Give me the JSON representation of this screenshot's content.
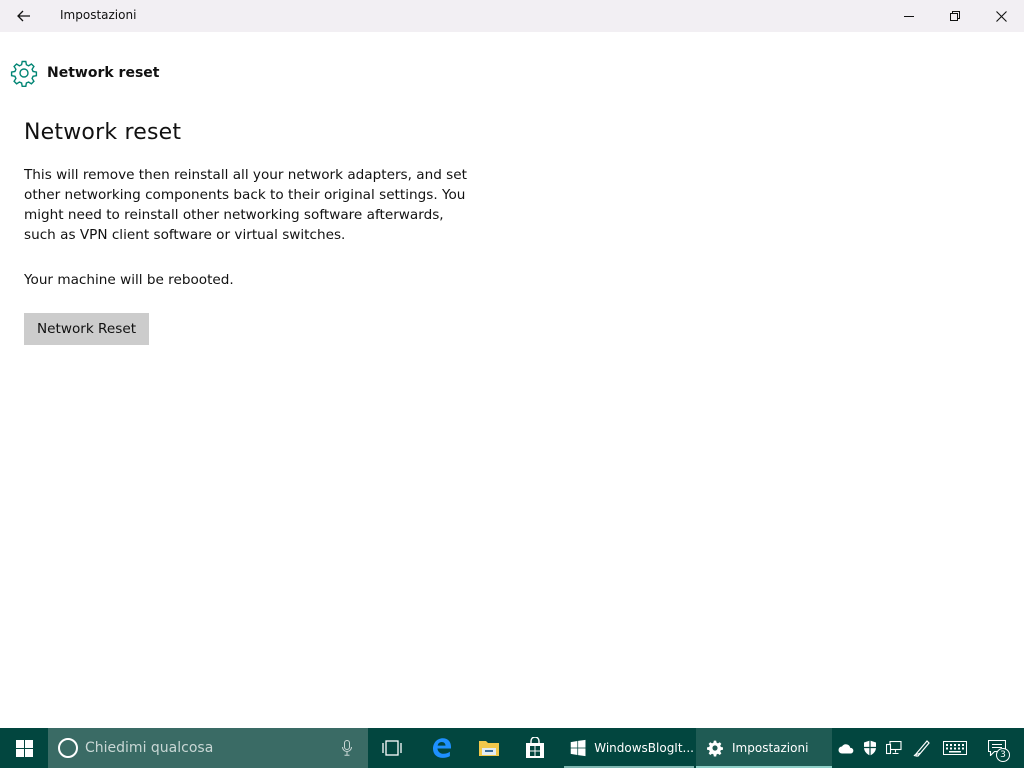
{
  "window": {
    "title": "Impostazioni"
  },
  "header": {
    "title": "Network reset"
  },
  "main": {
    "heading": "Network reset",
    "description": "This will remove then reinstall all your network adapters, and set other networking components back to their original settings. You might need to reinstall other networking software afterwards, such as VPN client software or virtual switches.",
    "reboot_note": "Your machine will be rebooted.",
    "reset_button_label": "Network Reset"
  },
  "taskbar": {
    "search_placeholder": "Chiedimi qualcosa",
    "apps": [
      {
        "label": "WindowsBlogIt...",
        "icon": "windowsblog-app-icon"
      },
      {
        "label": "Impostazioni",
        "icon": "gear-icon"
      }
    ],
    "notification_count": "3"
  },
  "colors": {
    "accent": "#018574",
    "taskbar": "#02463f",
    "titlebar": "#f2eff3",
    "button": "#cccccc"
  }
}
